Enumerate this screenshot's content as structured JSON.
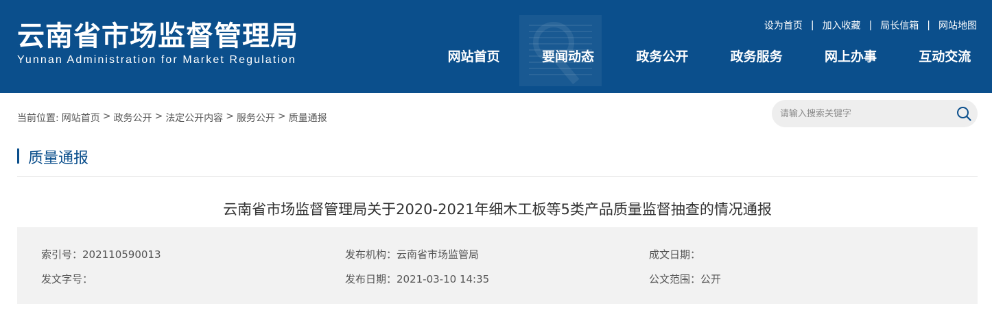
{
  "header": {
    "title_cn": "云南省市场监督管理局",
    "title_en": "Yunnan Administration for Market Regulation",
    "toplinks": [
      "设为首页",
      "加入收藏",
      "局长信箱",
      "网站地图"
    ],
    "separator": "|",
    "nav": [
      "网站首页",
      "要闻动态",
      "政务公开",
      "政务服务",
      "网上办事",
      "互动交流"
    ]
  },
  "breadcrumb": {
    "prefix": "当前位置:",
    "items": [
      "网站首页",
      "政务公开",
      "法定公开内容",
      "服务公开",
      "质量通报"
    ],
    "separator": ">"
  },
  "search": {
    "placeholder": "请输入搜索关键字",
    "icon": "search-icon"
  },
  "section": {
    "title": "质量通报"
  },
  "article": {
    "title": "云南省市场监督管理局关于2020-2021年细木工板等5类产品质量监督抽查的情况通报",
    "meta": {
      "index_no": "索引号：202110590013",
      "publisher": "发布机构：云南省市场监管局",
      "created_date": "成文日期：",
      "doc_no": "发文字号：",
      "publish_date": "发布日期：2021-03-10 14:35",
      "scope": "公文范围：公开"
    }
  },
  "colors": {
    "primary": "#0b4f8c",
    "meta_bg": "#f2f2f2",
    "search_bg": "#eeeeee"
  }
}
